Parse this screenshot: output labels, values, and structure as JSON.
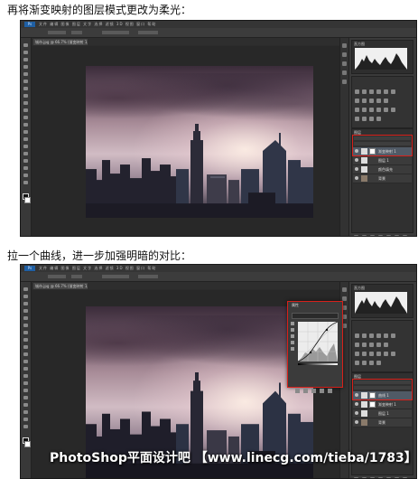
{
  "captions": {
    "step1": "再将渐变映射的图层模式更改为柔光：",
    "step2": "拉一个曲线，进一步加强明暗的对比："
  },
  "photoshop": {
    "logo": "Ps",
    "menu_text": "文件 编辑 图像 图层 文字 选择 滤镜 3D 视图 窗口 帮助",
    "doc_tab": "城市.jpg @ 66.7% (渐变映射 1, 图层蒙版/8)",
    "histogram_title": "直方图",
    "layers_tab": "图层",
    "layers_shot1": [
      "渐变映射 1",
      "图层 1",
      "颜色填充",
      "背景"
    ],
    "layers_shot2": [
      "曲线 1",
      "渐变映射 1",
      "图层 1",
      "背景"
    ],
    "properties_title": "属性",
    "curves_label": "曲线"
  },
  "colors": {
    "highlight": "#d8201a",
    "ps_dark": "#2b2b2b"
  },
  "watermark": "PhotoShop平面设计吧 【www.linecg.com/tieba/1783】"
}
